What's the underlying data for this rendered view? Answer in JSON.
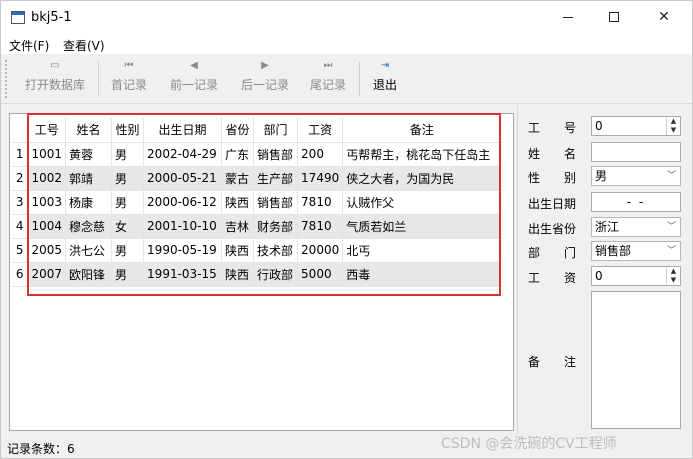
{
  "window": {
    "title": "bkj5-1"
  },
  "menu": [
    "文件(F)",
    "查看(V)"
  ],
  "toolbar": {
    "open_db": "打开数据库",
    "first": "首记录",
    "prev": "前一记录",
    "next": "后一记录",
    "last": "尾记录",
    "exit": "退出"
  },
  "table": {
    "headers": [
      "工号",
      "姓名",
      "性别",
      "出生日期",
      "省份",
      "部门",
      "工资",
      "备注"
    ],
    "row_numbers": [
      "1",
      "2",
      "3",
      "4",
      "5",
      "6"
    ],
    "rows": [
      [
        "1001",
        "黄蓉",
        "男",
        "2002-04-29",
        "广东",
        "销售部",
        "200",
        "丐帮帮主，桃花岛下任岛主"
      ],
      [
        "1002",
        "郭靖",
        "男",
        "2000-05-21",
        "蒙古",
        "生产部",
        "17490",
        "侠之大者，为国为民"
      ],
      [
        "1003",
        "杨康",
        "男",
        "2000-06-12",
        "陕西",
        "销售部",
        "7810",
        "认贼作父"
      ],
      [
        "1004",
        "穆念慈",
        "女",
        "2001-10-10",
        "吉林",
        "财务部",
        "7810",
        "气质若如兰"
      ],
      [
        "2005",
        "洪七公",
        "男",
        "1990-05-19",
        "陕西",
        "技术部",
        "20000",
        "北丐"
      ],
      [
        "2007",
        "欧阳锋",
        "男",
        "1991-03-15",
        "陕西",
        "行政部",
        "5000",
        "西毒"
      ]
    ]
  },
  "form": {
    "id_label": "工　　号",
    "id_value": "0",
    "name_label": "姓　　名",
    "gender_label": "性　　别",
    "gender_value": "男",
    "birth_label": "出生日期",
    "birth_value": "- -",
    "province_label": "出生省份",
    "province_value": "浙江",
    "dept_label": "部　　门",
    "dept_value": "销售部",
    "salary_label": "工　　资",
    "salary_value": "0",
    "notes_label": "备　　注"
  },
  "status": {
    "record_count": "记录条数：6"
  },
  "watermark": "CSDN @会洗碗的CV工程师",
  "colors": {
    "highlight": "#d9342b",
    "alt_row": "#e8e8e8"
  },
  "icons": [
    "app-icon",
    "folder-open-icon",
    "first-record-icon",
    "prev-record-icon",
    "next-record-icon",
    "last-record-icon",
    "exit-icon"
  ]
}
